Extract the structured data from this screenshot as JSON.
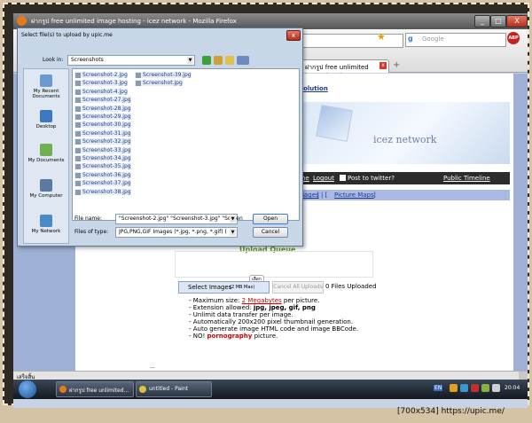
{
  "browser": {
    "title": "ฝากรูป free unlimited image hosting - icez network - Mozilla Firefox",
    "search_placeholder": "Google",
    "search_engine_glyph": "g",
    "bookmark_glyph": "★",
    "adblock_label": "ABP",
    "tab_label": "ฝากรูป free unlimited image hostin...",
    "tab_close": "x",
    "new_tab": "+",
    "minimize": "_",
    "maximize": "□",
    "close": "X",
    "status_text": "เสร็จสิ้น"
  },
  "page": {
    "nav_link": "ort Solution",
    "logo_text": "icez network",
    "nav": {
      "home": "Home",
      "logout": "Logout",
      "post_twitter": "Post to twitter?",
      "public_timeline": "Public Timeline"
    },
    "band_links": {
      "left": "ry images",
      "sep": "] | [",
      "picture_maps": "Picture Maps",
      "end": "]"
    },
    "upload_queue": "Upload Queue",
    "select_images": "Select Images",
    "max_note": "(2 MB Max)",
    "tooltip": "เลือก",
    "cancel_all": "Cancel All Uploads",
    "files_uploaded": "0 Files Uploaded",
    "bullets": {
      "b1_pre": "- Maximum size: ",
      "b1_link": "2 Megabytes",
      "b1_post": " per picture.",
      "b2_pre": "- Extension allowed: ",
      "b2_bold": "jpg, jpeg, gif, png",
      "b3": "- Unlimit data transfer per image.",
      "b4": "- Automatically 200x200 pixel thumbnail generation.",
      "b5": "- Auto generate image HTML code and image BBCode.",
      "b6_pre": "- NO! ",
      "b6_red": "pornography",
      "b6_post": " picture."
    },
    "stray": "..."
  },
  "dialog": {
    "title": "Select file(s) to upload by upic.me",
    "close": "x",
    "look_in_label": "Look in:",
    "look_in_value": "Screenshots",
    "places": [
      "My Recent Documents",
      "Desktop",
      "My Documents",
      "My Computer",
      "My Network"
    ],
    "files_col1": [
      "Screenshot-2.jpg",
      "Screenshot-3.jpg",
      "Screenshot-4.jpg",
      "Screenshot-27.jpg",
      "Screenshot-28.jpg",
      "Screenshot-29.jpg",
      "Screenshot-30.jpg",
      "Screenshot-31.jpg",
      "Screenshot-32.jpg",
      "Screenshot-33.jpg",
      "Screenshot-34.jpg",
      "Screenshot-35.jpg",
      "Screenshot-36.jpg",
      "Screenshot-37.jpg",
      "Screenshot-38.jpg"
    ],
    "files_col2": [
      "Screenshot-39.jpg",
      "Screenshot.jpg"
    ],
    "file_name_label": "File name:",
    "file_name_value": "\"Screenshot-2.jpg\" \"Screenshot-3.jpg\" \"Screen",
    "files_of_type_label": "Files of type:",
    "files_of_type_value": "JPG,PNG,GIF Images (*.jpg, *.png, *.gif) (*.jpg;*",
    "open": "Open",
    "cancel": "Cancel"
  },
  "taskbar": {
    "task1": "ฝากรูป free unlimited...",
    "task2": "untitled - Paint",
    "lang": "EN",
    "clock": "20:04"
  },
  "credit": "[700x534] https://upic.me/"
}
